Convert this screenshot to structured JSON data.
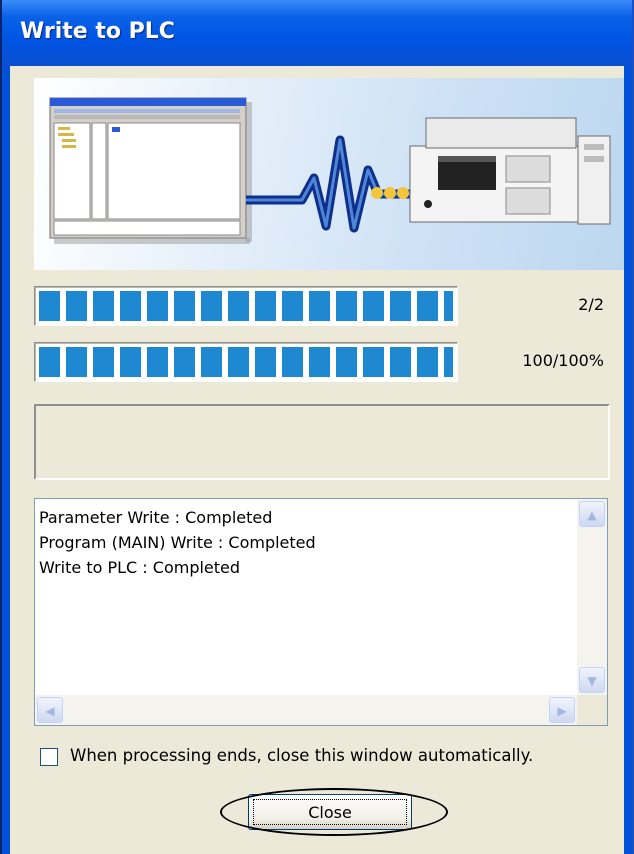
{
  "window": {
    "title": "Write to PLC"
  },
  "progress": {
    "file_count_label": "2/2",
    "file_fraction": 1.0,
    "percent_label": "100/100%",
    "percent_fraction": 1.0
  },
  "status_text": "",
  "log": {
    "lines": [
      "Parameter Write : Completed",
      "Program (MAIN) Write : Completed",
      "Write to PLC : Completed"
    ]
  },
  "auto_close": {
    "label": "When processing ends, close this window automatically.",
    "checked": false
  },
  "buttons": {
    "close_label": "Close"
  },
  "colors": {
    "titlebar": "#0054e3",
    "progress_fill": "#1e88d0",
    "dialog_bg": "#ece9d8"
  },
  "icons": {
    "scroll_up": "chevron-up-icon",
    "scroll_down": "chevron-down-icon",
    "scroll_left": "chevron-left-icon",
    "scroll_right": "chevron-right-icon"
  }
}
